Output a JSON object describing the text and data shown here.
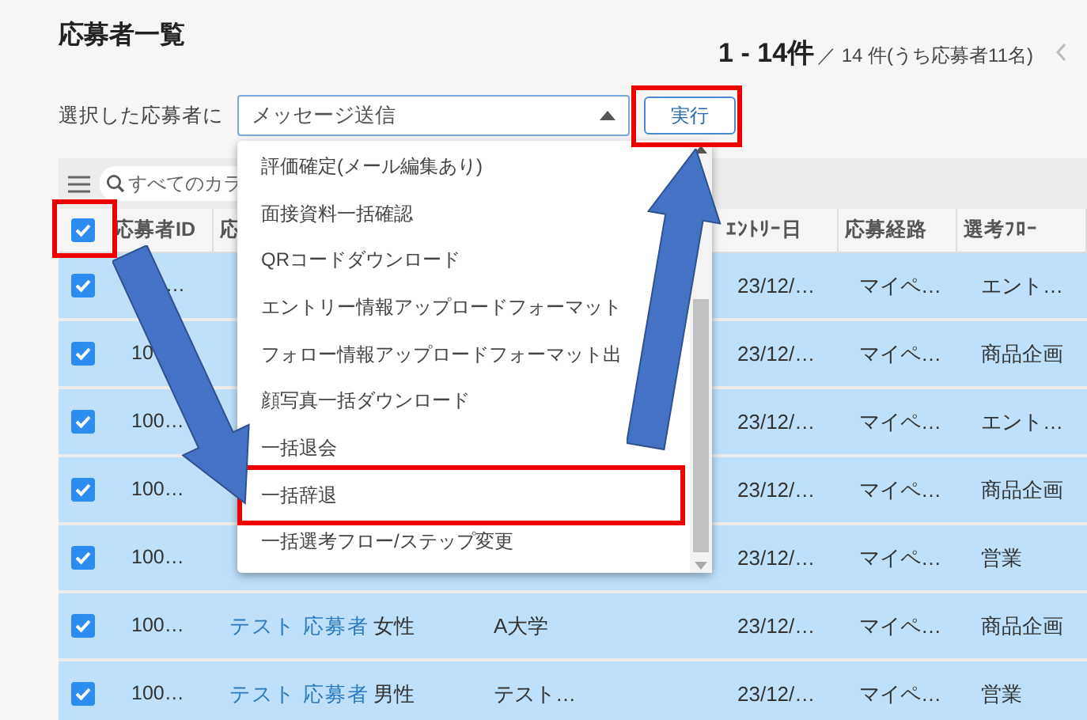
{
  "page_title": "応募者一覧",
  "pagination": {
    "range": "1 - 14件",
    "total": "／ 14 件(うち応募者11名)"
  },
  "bulk_action": {
    "label": "選択した応募者に",
    "select_value": "メッセージ送信",
    "expanded": true,
    "execute_button": "実行"
  },
  "dropdown_options": [
    {
      "label": "評価確定(メール編集あり)",
      "selected": false
    },
    {
      "label": "面接資料一括確認",
      "selected": false
    },
    {
      "label": "QRコードダウンロード",
      "selected": false
    },
    {
      "label": "エントリー情報アップロードフォーマット",
      "selected": false
    },
    {
      "label": "フォロー情報アップロードフォーマット出",
      "selected": false
    },
    {
      "label": "顔写真一括ダウンロード",
      "selected": false
    },
    {
      "label": "一括退会",
      "selected": false
    },
    {
      "label": "一括辞退",
      "selected": false
    },
    {
      "label": "一括選考フロー/ステップ変更",
      "selected": false
    }
  ],
  "search": {
    "placeholder": "すべてのカラ"
  },
  "table": {
    "select_all_checked": true,
    "columns": [
      {
        "label": "応募者ID"
      },
      {
        "label": "応"
      },
      {},
      {},
      {
        "label": "ｴﾝﾄﾘｰ日"
      },
      {
        "label": "応募経路"
      },
      {
        "label": "選考ﾌﾛｰ"
      }
    ],
    "rows": [
      {
        "checked": true,
        "id": "…",
        "id_start_covered": true,
        "entry_date": "23/12/…",
        "route": "マイペ…",
        "flow": "エント…"
      },
      {
        "checked": true,
        "id": "10",
        "id_start_covered": false,
        "entry_date": "23/12/…",
        "route": "マイペ…",
        "flow": "商品企画"
      },
      {
        "checked": true,
        "id": "100…",
        "entry_date": "23/12/…",
        "route": "マイペ…",
        "flow": "エント…"
      },
      {
        "checked": true,
        "id": "100…",
        "entry_date": "23/12/…",
        "route": "マイペ…",
        "flow": "商品企画"
      },
      {
        "checked": true,
        "id": "100…",
        "entry_date": "23/12/…",
        "route": "マイペ…",
        "flow": "営業"
      },
      {
        "checked": true,
        "id": "100…",
        "name": "テスト 応募者",
        "gender": "女性",
        "school": "A大学",
        "entry_date": "23/12/…",
        "route": "マイペ…",
        "flow": "商品企画"
      },
      {
        "checked": true,
        "id": "100…",
        "name": "テスト 応募者",
        "gender": "男性",
        "school": "テスト…",
        "entry_date": "23/12/…",
        "route": "マイペ…",
        "flow": "営業"
      }
    ]
  },
  "annotations": [
    {
      "kind": "box"
    },
    {
      "kind": "box"
    },
    {
      "kind": "box"
    },
    {
      "kind": "arrow"
    },
    {
      "kind": "arrow"
    }
  ]
}
